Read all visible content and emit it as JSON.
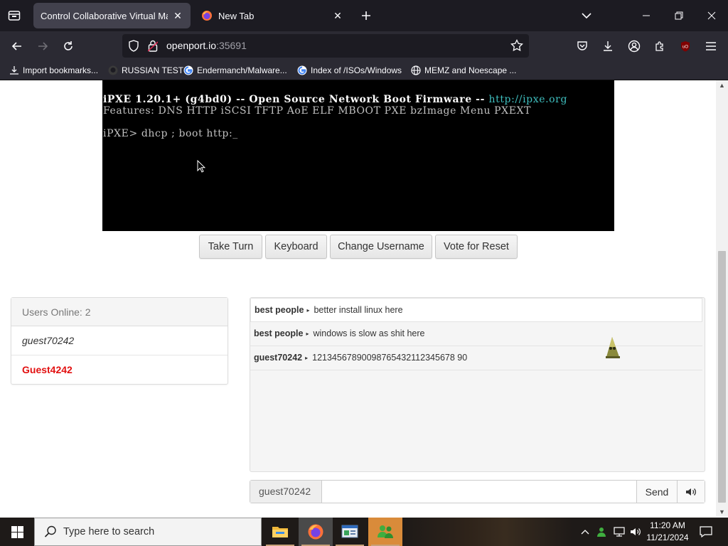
{
  "browser": {
    "tabs": [
      {
        "title": "Control Collaborative Virtual Machi",
        "active": true
      },
      {
        "title": "New Tab",
        "active": false
      }
    ],
    "url_host": "openport.io",
    "url_port": ":35691",
    "bookmarks": [
      {
        "label": "Import bookmarks...",
        "icon": "import-icon"
      },
      {
        "label": "RUSSIAN TEST",
        "icon": "github-icon"
      },
      {
        "label": "Endermanch/Malware...",
        "icon": "google-icon"
      },
      {
        "label": "Index of /ISOs/Windows",
        "icon": "google-icon"
      },
      {
        "label": "MEMZ and Noescape ...",
        "icon": "globe-icon"
      }
    ]
  },
  "vm": {
    "line1_prefix": "iPXE 1.20.1+ (g4bd0) -- Open Source Network Boot Firmware -- ",
    "line1_link": "http://ipxe.org",
    "line2": "Features: DNS HTTP iSCSI TFTP AoE ELF MBOOT PXE bzImage Menu PXEXT",
    "line3": "iPXE> dhcp ; boot http:_"
  },
  "controls": {
    "take_turn": "Take Turn",
    "keyboard": "Keyboard",
    "change_username": "Change Username",
    "vote_reset": "Vote for Reset"
  },
  "users": {
    "header": "Users Online: 2",
    "list": [
      "guest70242",
      "Guest4242"
    ]
  },
  "chat": {
    "messages": [
      {
        "user": "best people",
        "text": "better install linux here"
      },
      {
        "user": "best people",
        "text": "windows is slow as shit here"
      },
      {
        "user": "guest70242",
        "text": "12134567890098765432112345678 90"
      }
    ],
    "username": "guest70242",
    "input_value": "",
    "send_label": "Send"
  },
  "taskbar": {
    "search_placeholder": "Type here to search",
    "time": "11:20 AM",
    "date": "11/21/2024"
  },
  "colors": {
    "accent_user": "#e21111",
    "firefox_dark": "#1c1b22",
    "toolbar": "#2b2a33"
  }
}
